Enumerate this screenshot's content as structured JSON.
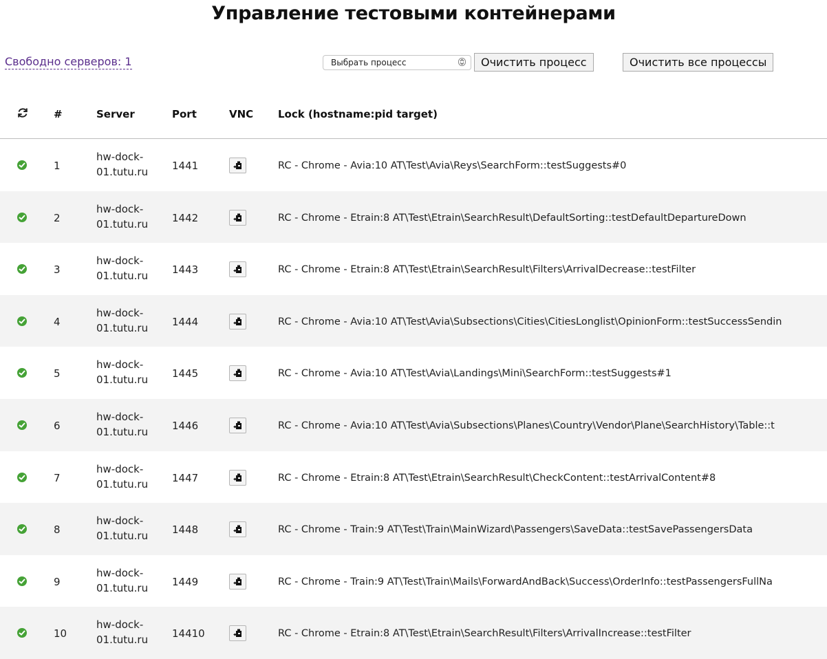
{
  "page": {
    "title": "Управление тестовыми контейнерами",
    "free_servers": "Свободно серверов: 1"
  },
  "controls": {
    "process_select": {
      "selected": "Выбрать процесс"
    },
    "clear_process_label": "Очистить процесс",
    "clear_all_label": "Очистить все процессы"
  },
  "table": {
    "headers": {
      "status_icon": "refresh-icon",
      "num": "#",
      "server": "Server",
      "port": "Port",
      "vnc": "VNC",
      "lock": "Lock (hostname:pid target)"
    },
    "rows": [
      {
        "status": "ok-icon",
        "num": "1",
        "server": "hw-dock-01.tutu.ru",
        "port": "1441",
        "lock": "RC - Chrome - Avia:10 AT\\Test\\Avia\\Reys\\SearchForm::testSuggests#0"
      },
      {
        "status": "ok-icon",
        "num": "2",
        "server": "hw-dock-01.tutu.ru",
        "port": "1442",
        "lock": "RC - Chrome - Etrain:8 AT\\Test\\Etrain\\SearchResult\\DefaultSorting::testDefaultDepartureDown"
      },
      {
        "status": "ok-icon",
        "num": "3",
        "server": "hw-dock-01.tutu.ru",
        "port": "1443",
        "lock": "RC - Chrome - Etrain:8 AT\\Test\\Etrain\\SearchResult\\Filters\\ArrivalDecrease::testFilter"
      },
      {
        "status": "ok-icon",
        "num": "4",
        "server": "hw-dock-01.tutu.ru",
        "port": "1444",
        "lock": "RC - Chrome - Avia:10 AT\\Test\\Avia\\Subsections\\Cities\\CitiesLonglist\\OpinionForm::testSuccessSendin"
      },
      {
        "status": "ok-icon",
        "num": "5",
        "server": "hw-dock-01.tutu.ru",
        "port": "1445",
        "lock": "RC - Chrome - Avia:10 AT\\Test\\Avia\\Landings\\Mini\\SearchForm::testSuggests#1"
      },
      {
        "status": "ok-icon",
        "num": "6",
        "server": "hw-dock-01.tutu.ru",
        "port": "1446",
        "lock": "RC - Chrome - Avia:10 AT\\Test\\Avia\\Subsections\\Planes\\Country\\Vendor\\Plane\\SearchHistory\\Table::t"
      },
      {
        "status": "ok-icon",
        "num": "7",
        "server": "hw-dock-01.tutu.ru",
        "port": "1447",
        "lock": "RC - Chrome - Etrain:8 AT\\Test\\Etrain\\SearchResult\\CheckContent::testArrivalContent#8"
      },
      {
        "status": "ok-icon",
        "num": "8",
        "server": "hw-dock-01.tutu.ru",
        "port": "1448",
        "lock": "RC - Chrome - Train:9 AT\\Test\\Train\\MainWizard\\Passengers\\SaveData::testSavePassengersData"
      },
      {
        "status": "ok-icon",
        "num": "9",
        "server": "hw-dock-01.tutu.ru",
        "port": "1449",
        "lock": "RC - Chrome - Train:9 AT\\Test\\Train\\Mails\\ForwardAndBack\\Success\\OrderInfo::testPassengersFullNa"
      },
      {
        "status": "ok-icon",
        "num": "10",
        "server": "hw-dock-01.tutu.ru",
        "port": "14410",
        "lock": "RC - Chrome - Etrain:8 AT\\Test\\Etrain\\SearchResult\\Filters\\ArrivalIncrease::testFilter"
      }
    ]
  },
  "colors": {
    "ok": "#45a236",
    "link": "#5a2d8c",
    "row_alt": "#f3f3f3"
  }
}
